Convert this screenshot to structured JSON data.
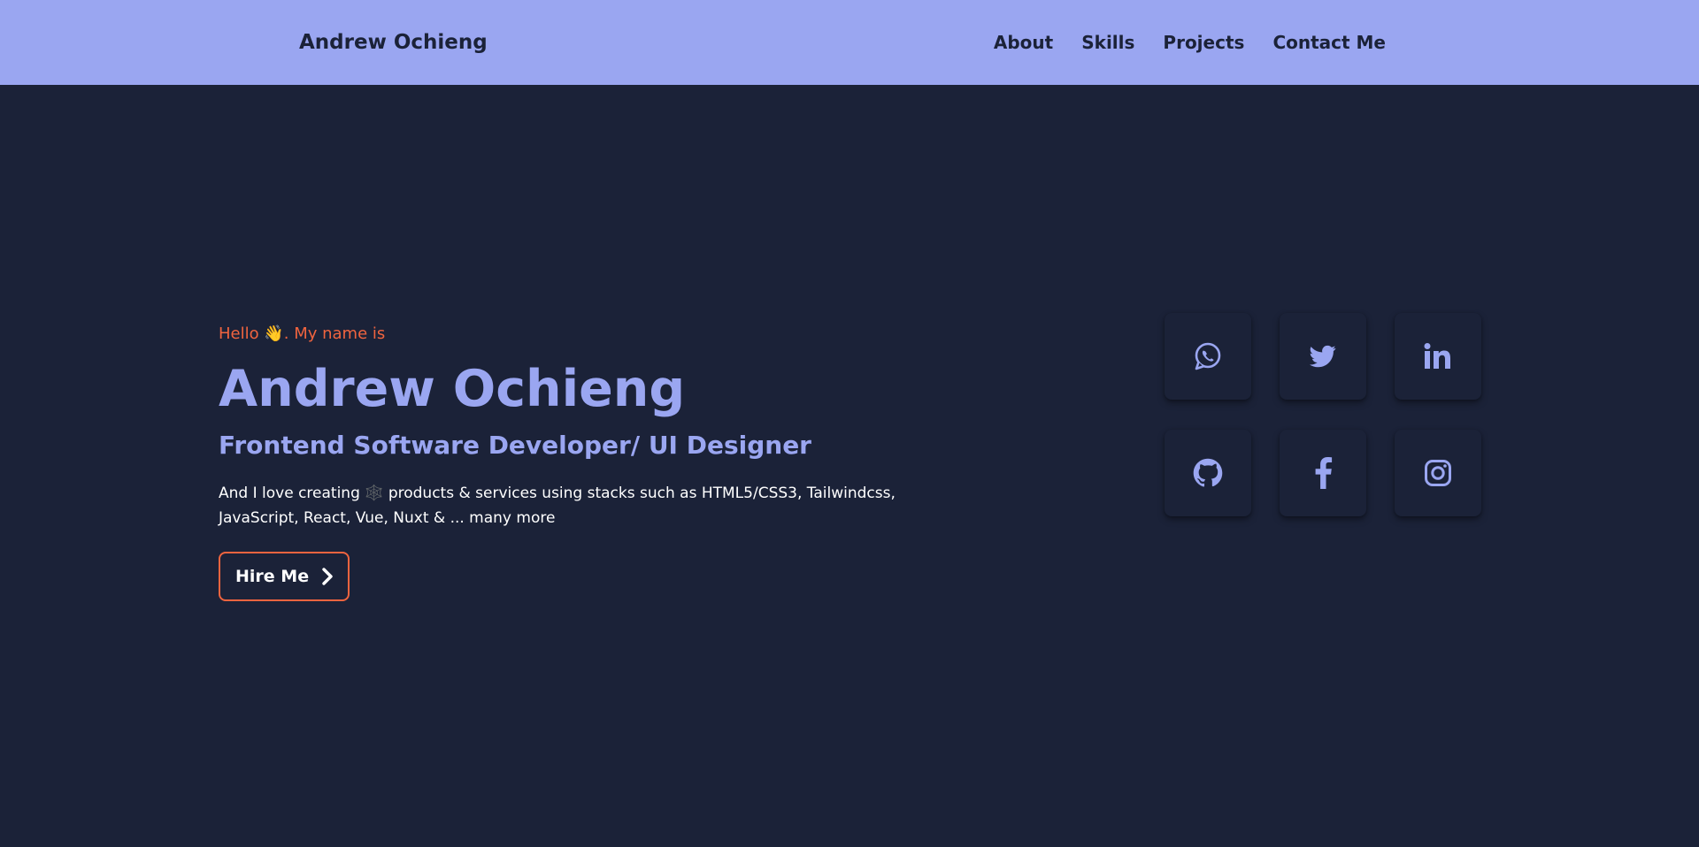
{
  "header": {
    "brand": "Andrew Ochieng",
    "nav": [
      {
        "label": "About"
      },
      {
        "label": "Skills"
      },
      {
        "label": "Projects"
      },
      {
        "label": "Contact Me"
      }
    ]
  },
  "hero": {
    "greeting": "Hello 👋. My name is",
    "name": "Andrew Ochieng",
    "role": "Frontend Software Developer/ UI Designer",
    "description": "And I love creating 🕸️ products & services using stacks such as HTML5/CSS3, Tailwindcss, JavaScript, React, Vue, Nuxt & ... many more",
    "cta": {
      "label": "Hire Me",
      "icon": "chevron-right-icon"
    }
  },
  "social": [
    {
      "name": "whatsapp",
      "icon": "whatsapp-icon"
    },
    {
      "name": "twitter",
      "icon": "twitter-icon"
    },
    {
      "name": "linkedin",
      "icon": "linkedin-icon"
    },
    {
      "name": "github",
      "icon": "github-icon"
    },
    {
      "name": "facebook",
      "icon": "facebook-icon"
    },
    {
      "name": "instagram",
      "icon": "instagram-icon"
    }
  ],
  "colors": {
    "background": "#1b2238",
    "accent": "#9aa6f1",
    "highlight": "#f0643f",
    "text": "#ffffff"
  }
}
